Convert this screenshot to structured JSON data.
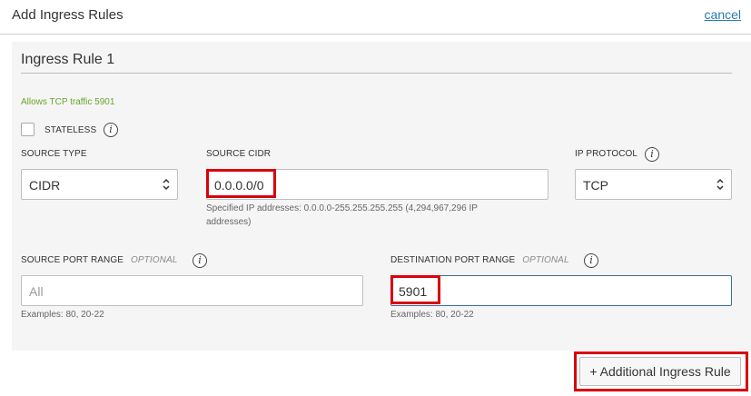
{
  "header": {
    "title": "Add Ingress Rules",
    "cancel_label": "cancel"
  },
  "rule": {
    "title": "Ingress Rule 1",
    "description": "Allows TCP traffic 5901",
    "stateless": {
      "label": "STATELESS",
      "checked": false
    },
    "source_type": {
      "label": "SOURCE TYPE",
      "value": "CIDR"
    },
    "source_cidr": {
      "label": "SOURCE CIDR",
      "value": "0.0.0.0/0",
      "hint_line1": "Specified IP addresses: 0.0.0.0-255.255.255.255 (4,294,967,296 IP",
      "hint_line2": "addresses)"
    },
    "ip_protocol": {
      "label": "IP PROTOCOL",
      "value": "TCP"
    },
    "source_port_range": {
      "label": "SOURCE PORT RANGE",
      "optional": "OPTIONAL",
      "placeholder": "All",
      "hint": "Examples: 80, 20-22"
    },
    "destination_port_range": {
      "label": "DESTINATION PORT RANGE",
      "optional": "OPTIONAL",
      "value": "5901",
      "hint": "Examples: 80, 20-22"
    },
    "info_glyph": "i"
  },
  "additional_rule_label": "+ Additional Ingress Rule"
}
